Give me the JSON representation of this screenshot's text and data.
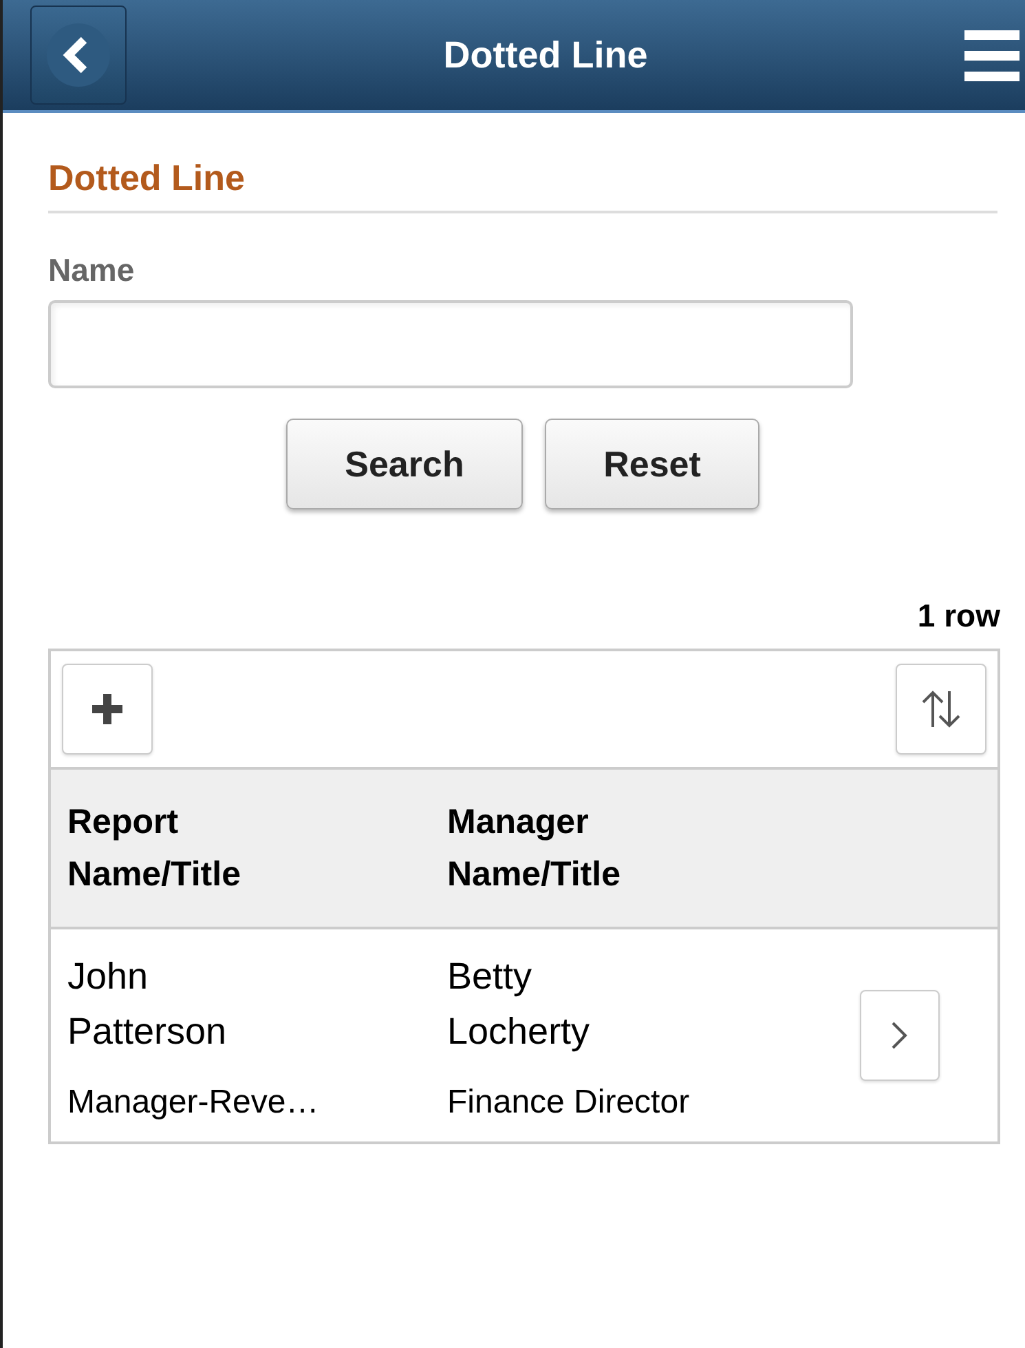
{
  "header": {
    "title": "Dotted Line"
  },
  "section": {
    "title": "Dotted Line"
  },
  "search": {
    "label": "Name",
    "buttons": [
      "Search",
      "Reset"
    ]
  },
  "grid": {
    "row_count": "1 row",
    "columns": [
      "Report Name/Title",
      "Manager Name/Title"
    ],
    "rows": [
      {
        "report_name": "John Patterson",
        "report_title": "Manager-Reve…",
        "manager_name": "Betty Locherty",
        "manager_title": "Finance Director"
      }
    ]
  }
}
